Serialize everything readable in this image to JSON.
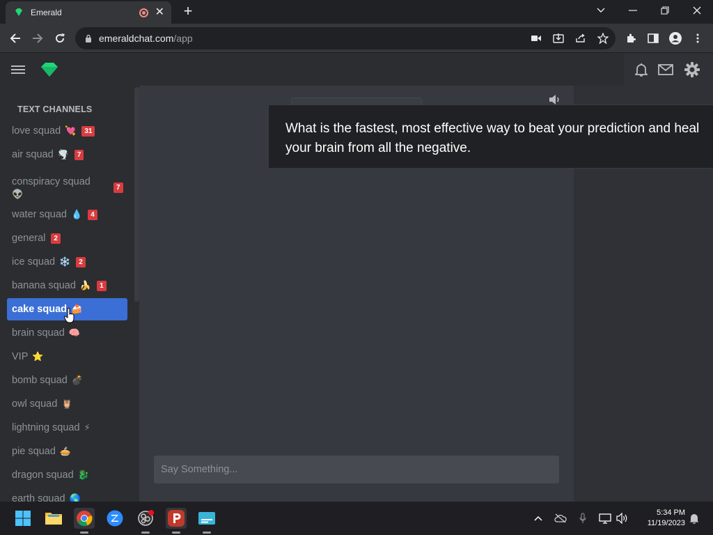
{
  "browser": {
    "tab_title": "Emerald",
    "url_host": "emeraldchat.com",
    "url_path": "/app"
  },
  "sidebar": {
    "heading": "TEXT CHANNELS",
    "channels": [
      {
        "name": "love squad",
        "emoji": "💘",
        "badge": "31"
      },
      {
        "name": "air squad",
        "emoji": "🌪️",
        "badge": "7"
      },
      {
        "name": "conspiracy squad",
        "emoji": "👽",
        "badge": "7"
      },
      {
        "name": "water squad",
        "emoji": "💧",
        "badge": "4"
      },
      {
        "name": "general",
        "emoji": "",
        "badge": "2"
      },
      {
        "name": "ice squad",
        "emoji": "❄️",
        "badge": "2"
      },
      {
        "name": "banana squad",
        "emoji": "🍌",
        "badge": "1"
      },
      {
        "name": "cake squad",
        "emoji": "🍰",
        "badge": ""
      },
      {
        "name": "brain squad",
        "emoji": "🧠",
        "badge": ""
      },
      {
        "name": "VIP",
        "emoji": "⭐",
        "badge": ""
      },
      {
        "name": "bomb squad",
        "emoji": "💣",
        "badge": ""
      },
      {
        "name": "owl squad",
        "emoji": "🦉",
        "badge": ""
      },
      {
        "name": "lightning squad",
        "emoji": "⚡",
        "badge": ""
      },
      {
        "name": "pie squad",
        "emoji": "🥧",
        "badge": ""
      },
      {
        "name": "dragon squad",
        "emoji": "🐉",
        "badge": ""
      },
      {
        "name": "earth squad",
        "emoji": "🌎",
        "badge": ""
      }
    ]
  },
  "main": {
    "input_placeholder": "Say Something..."
  },
  "caption": {
    "text": "What is the fastest, most effective way to beat your prediction and heal your brain from all the negative."
  },
  "taskbar": {
    "time": "5:34 PM",
    "date": "11/19/2023"
  },
  "colors": {
    "accent": "#3b6fd6",
    "badge": "#d83c3e",
    "emerald": "#1fd67a"
  }
}
